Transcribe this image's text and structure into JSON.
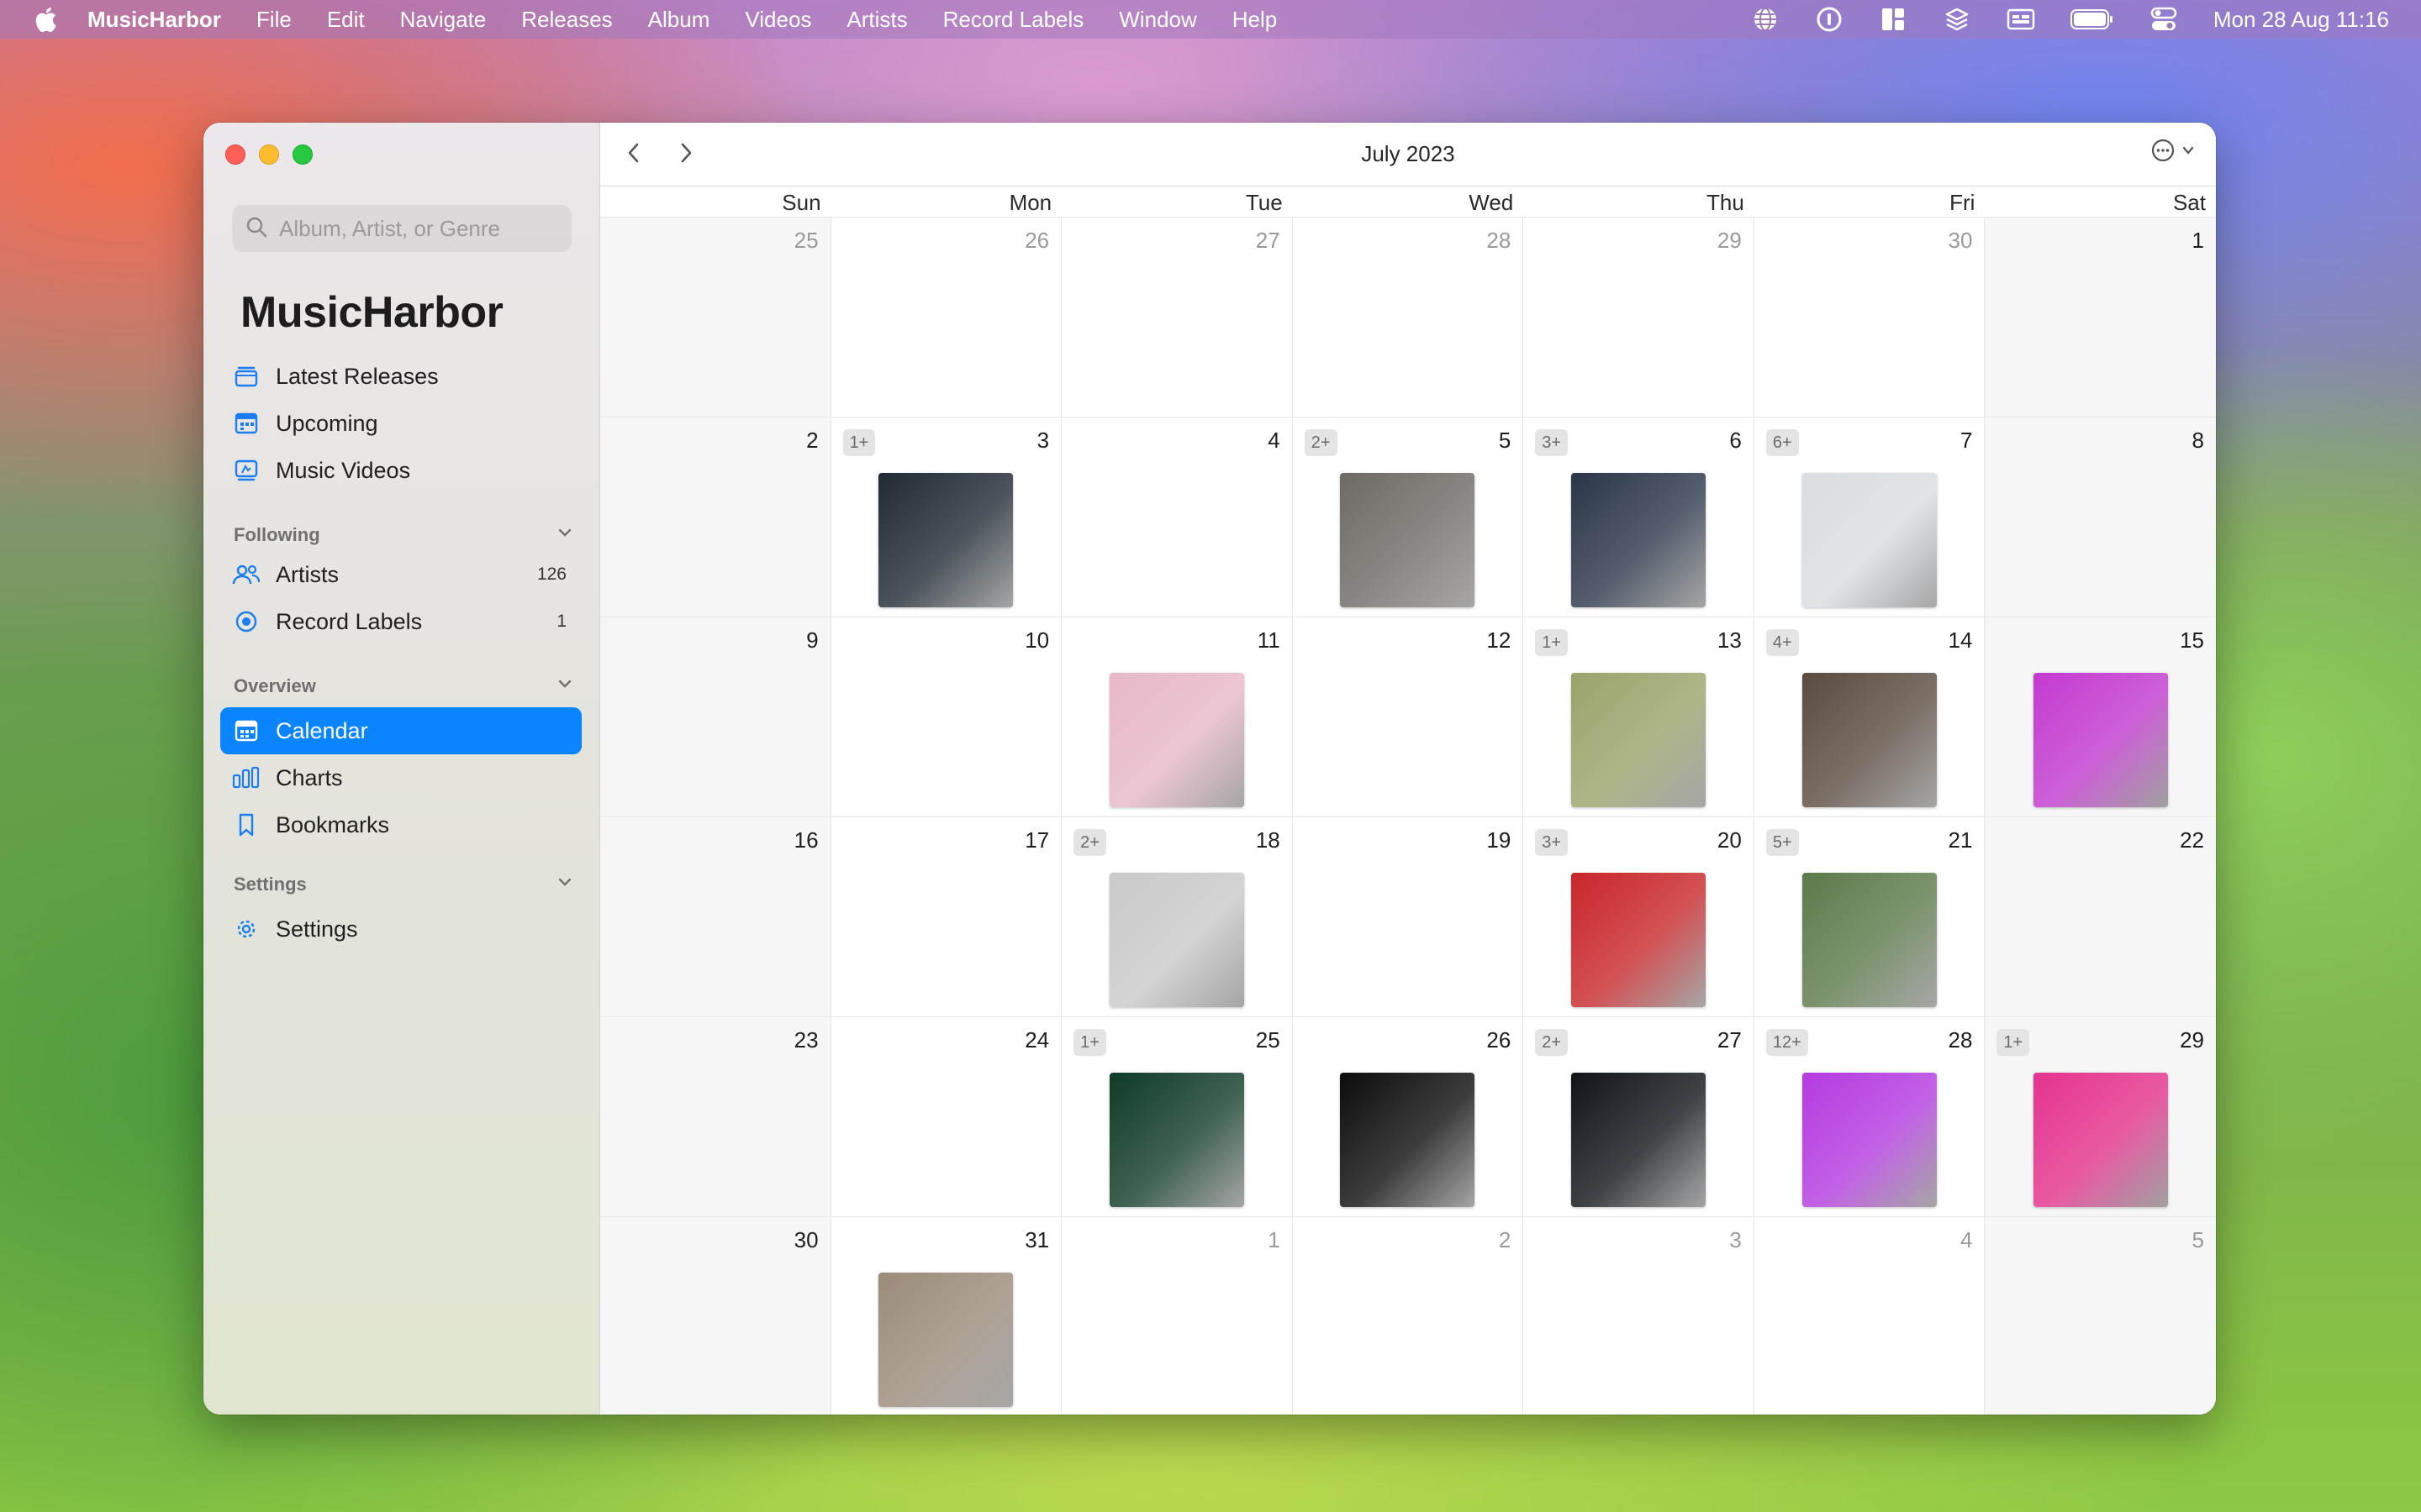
{
  "menubar": {
    "app_name": "MusicHarbor",
    "menus": [
      "File",
      "Edit",
      "Navigate",
      "Releases",
      "Album",
      "Videos",
      "Artists",
      "Record Labels",
      "Window",
      "Help"
    ],
    "clock": "Mon 28 Aug  11:16",
    "status_icons": [
      "globe-icon",
      "password-icon",
      "layout-icon",
      "layers-icon",
      "display-icon",
      "battery-icon",
      "control-center-icon"
    ]
  },
  "sidebar": {
    "search_placeholder": "Album, Artist, or Genre",
    "title": "MusicHarbor",
    "top_items": [
      {
        "label": "Latest Releases",
        "icon": "stack-icon"
      },
      {
        "label": "Upcoming",
        "icon": "calendar-upcoming-icon"
      },
      {
        "label": "Music Videos",
        "icon": "video-icon"
      }
    ],
    "following": {
      "header": "Following",
      "items": [
        {
          "label": "Artists",
          "count": "126",
          "icon": "people-icon"
        },
        {
          "label": "Record Labels",
          "count": "1",
          "icon": "record-icon"
        }
      ]
    },
    "overview": {
      "header": "Overview",
      "items": [
        {
          "label": "Calendar",
          "icon": "calendar-icon",
          "active": true
        },
        {
          "label": "Charts",
          "icon": "chart-icon"
        },
        {
          "label": "Bookmarks",
          "icon": "bookmark-icon"
        }
      ]
    },
    "settings": {
      "header": "Settings",
      "items": [
        {
          "label": "Settings",
          "icon": "gear-icon"
        }
      ]
    }
  },
  "toolbar": {
    "title": "July 2023"
  },
  "calendar": {
    "weekdays": [
      "Sun",
      "Mon",
      "Tue",
      "Wed",
      "Thu",
      "Fri",
      "Sat"
    ],
    "days": [
      {
        "d": "25",
        "other": true
      },
      {
        "d": "26",
        "other": true
      },
      {
        "d": "27",
        "other": true
      },
      {
        "d": "28",
        "other": true
      },
      {
        "d": "29",
        "other": true
      },
      {
        "d": "30",
        "other": true
      },
      {
        "d": "1"
      },
      {
        "d": "2"
      },
      {
        "d": "3",
        "badge": "1+",
        "art": "#1f2a33"
      },
      {
        "d": "4"
      },
      {
        "d": "5",
        "badge": "2+",
        "art": "#6d6a65"
      },
      {
        "d": "6",
        "badge": "3+",
        "art": "#2a3648"
      },
      {
        "d": "7",
        "badge": "6+",
        "art": "#d9dde0"
      },
      {
        "d": "8"
      },
      {
        "d": "9"
      },
      {
        "d": "10"
      },
      {
        "d": "11",
        "art": "#e7b8c7"
      },
      {
        "d": "12"
      },
      {
        "d": "13",
        "badge": "1+",
        "art": "#9aa36a"
      },
      {
        "d": "14",
        "badge": "4+",
        "art": "#5a4b3f"
      },
      {
        "d": "15",
        "art": "#c33ad0"
      },
      {
        "d": "16"
      },
      {
        "d": "17"
      },
      {
        "d": "18",
        "badge": "2+",
        "art": "#c9c9c9"
      },
      {
        "d": "19"
      },
      {
        "d": "20",
        "badge": "3+",
        "art": "#c8262a"
      },
      {
        "d": "21",
        "badge": "5+",
        "art": "#5c7a4a"
      },
      {
        "d": "22"
      },
      {
        "d": "23"
      },
      {
        "d": "24"
      },
      {
        "d": "25",
        "badge": "1+",
        "art": "#0f3b27"
      },
      {
        "d": "26",
        "art": "#0c0c0c"
      },
      {
        "d": "27",
        "badge": "2+",
        "art": "#101418"
      },
      {
        "d": "28",
        "badge": "12+",
        "art": "#b43ae0"
      },
      {
        "d": "29",
        "badge": "1+",
        "art": "#e5338e"
      },
      {
        "d": "30"
      },
      {
        "d": "31",
        "art": "#9a8b7a"
      },
      {
        "d": "1",
        "other": true
      },
      {
        "d": "2",
        "other": true
      },
      {
        "d": "3",
        "other": true
      },
      {
        "d": "4",
        "other": true
      },
      {
        "d": "5",
        "other": true
      }
    ]
  },
  "colors": {
    "accent": "#0a84ff",
    "sidebar_icon": "#1a7ef2"
  }
}
